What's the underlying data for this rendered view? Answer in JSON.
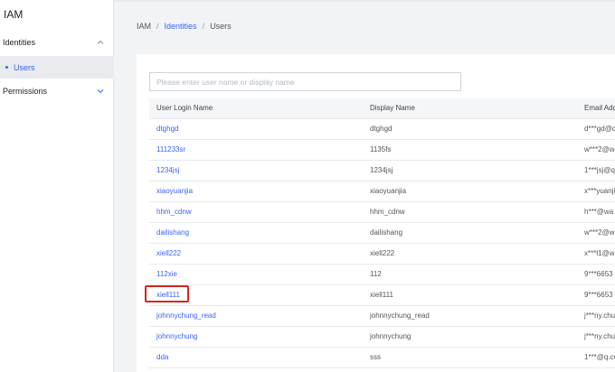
{
  "app": {
    "title": "IAM"
  },
  "sidebar": {
    "groups": [
      {
        "label": "Identities",
        "expanded": true,
        "items": [
          {
            "label": "Users",
            "active": true
          }
        ]
      },
      {
        "label": "Permissions",
        "expanded": false,
        "items": []
      }
    ]
  },
  "breadcrumb": [
    "IAM",
    "Identities",
    "Users"
  ],
  "search": {
    "placeholder": "Please enter user name or display name",
    "value": ""
  },
  "table": {
    "columns": [
      "User Login Name",
      "Display Name",
      "Email Add"
    ],
    "rows": [
      {
        "login": "dtghgd",
        "display": "dtghgd",
        "email": "d***gd@q"
      },
      {
        "login": "111233sr",
        "display": "1135fs",
        "email": "w***2@w"
      },
      {
        "login": "1234jsj",
        "display": "1234jsj",
        "email": "1***jsj@q"
      },
      {
        "login": "xiaoyuanjia",
        "display": "xiaoyuanjia",
        "email": "x***yuanji"
      },
      {
        "login": "hhm_cdnw",
        "display": "hhm_cdnw",
        "email": "h***@wa"
      },
      {
        "login": "dailishang",
        "display": "dailishang",
        "email": "w***2@w"
      },
      {
        "login": "xiell222",
        "display": "xiell222",
        "email": "x***l1@w"
      },
      {
        "login": "112xie",
        "display": "112",
        "email": "9***6653"
      },
      {
        "login": "xiell111",
        "display": "xiell111",
        "email": "9***6653"
      },
      {
        "login": "johnnychung_read",
        "display": "johnnychung_read",
        "email": "j***ny.chu"
      },
      {
        "login": "johnnychung",
        "display": "johnnychung",
        "email": "j***ny.chu"
      },
      {
        "login": "dda",
        "display": "sss",
        "email": "1***@q.co"
      }
    ]
  },
  "colors": {
    "accent": "#3b63f5",
    "highlight": "#d8261e",
    "background": "#f2f3f5"
  },
  "icons": {
    "identities_toggle": "chevron-up-icon",
    "permissions_toggle": "chevron-down-icon"
  }
}
